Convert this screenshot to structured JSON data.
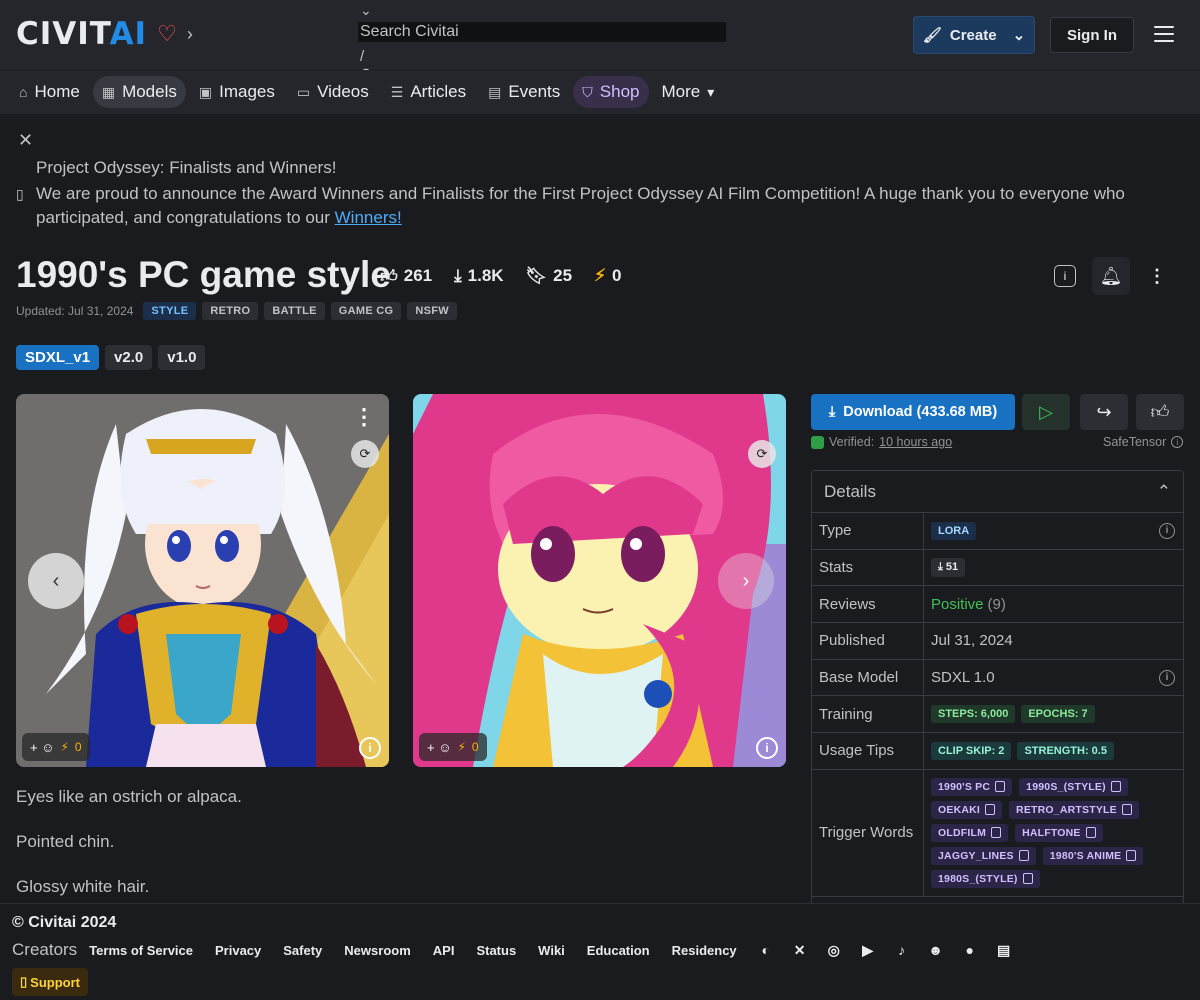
{
  "header": {
    "logo_text_1": "CIVIT",
    "logo_text_2": "AI",
    "search_placeholder": "Search Civitai",
    "search_shortcut": "/",
    "create_label": "Create",
    "signin_label": "Sign In"
  },
  "nav": {
    "items": [
      {
        "label": "Home",
        "icon": "home-icon"
      },
      {
        "label": "Models",
        "icon": "grid-icon"
      },
      {
        "label": "Images",
        "icon": "image-icon"
      },
      {
        "label": "Videos",
        "icon": "video-icon"
      },
      {
        "label": "Articles",
        "icon": "article-icon"
      },
      {
        "label": "Events",
        "icon": "calendar-icon"
      },
      {
        "label": "Shop",
        "icon": "shop-icon"
      },
      {
        "label": "More",
        "icon": "caret-down-icon"
      }
    ]
  },
  "announcement": {
    "title": "Project Odyssey: Finalists and Winners!",
    "body": "We are proud to announce the Award Winners and Finalists for the First Project Odyssey AI Film Competition! A huge thank you to everyone who participated, and congratulations to our ",
    "link": "Winners!"
  },
  "model": {
    "title": "1990's PC game style",
    "likes": "261",
    "downloads": "1.8K",
    "bookmarks": "25",
    "buzz": "0",
    "updated": "Updated: Jul 31, 2024",
    "tags": [
      "STYLE",
      "RETRO",
      "BATTLE",
      "GAME CG",
      "NSFW"
    ],
    "versions": [
      "SDXL_v1",
      "v2.0",
      "v1.0"
    ]
  },
  "images": [
    {
      "reaction_count": "0"
    },
    {
      "reaction_count": "0"
    }
  ],
  "description": [
    "Eyes like an ostrich or alpaca.",
    "Pointed chin.",
    "Glossy white hair."
  ],
  "sidebar": {
    "download_label": "Download (433.68 MB)",
    "verified_prefix": "Verified: ",
    "verified_time": "10 hours ago",
    "safetensor": "SafeTensor",
    "details_title": "Details",
    "rows": {
      "type_label": "Type",
      "type_value": "LORA",
      "stats_label": "Stats",
      "stats_value": "51",
      "reviews_label": "Reviews",
      "reviews_value": "Positive",
      "reviews_count": "(9)",
      "published_label": "Published",
      "published_value": "Jul 31, 2024",
      "base_label": "Base Model",
      "base_value": "SDXL 1.0",
      "training_label": "Training",
      "training_steps": "STEPS: 6,000",
      "training_epochs": "EPOCHS: 7",
      "usage_label": "Usage Tips",
      "usage_clip": "CLIP SKIP: 2",
      "usage_strength": "STRENGTH: 0.5",
      "trigger_label": "Trigger Words"
    },
    "trigger_words": [
      "1990'S PC",
      "1990S_(STYLE)",
      "OEKAKI",
      "RETRO_ARTSTYLE",
      "OLDFILM",
      "HALFTONE",
      "JAGGY_LINES",
      "1980'S ANIME",
      "1980S_(STYLE)"
    ]
  },
  "footer": {
    "copyright": "© Civitai 2024",
    "creators": "Creators",
    "links": [
      "Terms of Service",
      "Privacy",
      "Safety",
      "Newsroom",
      "API",
      "Status",
      "Wiki",
      "Education",
      "Residency"
    ],
    "support": "Support"
  },
  "colors": {
    "accent": "#1971c2",
    "positive": "#40c057",
    "buzz": "#fab005"
  }
}
